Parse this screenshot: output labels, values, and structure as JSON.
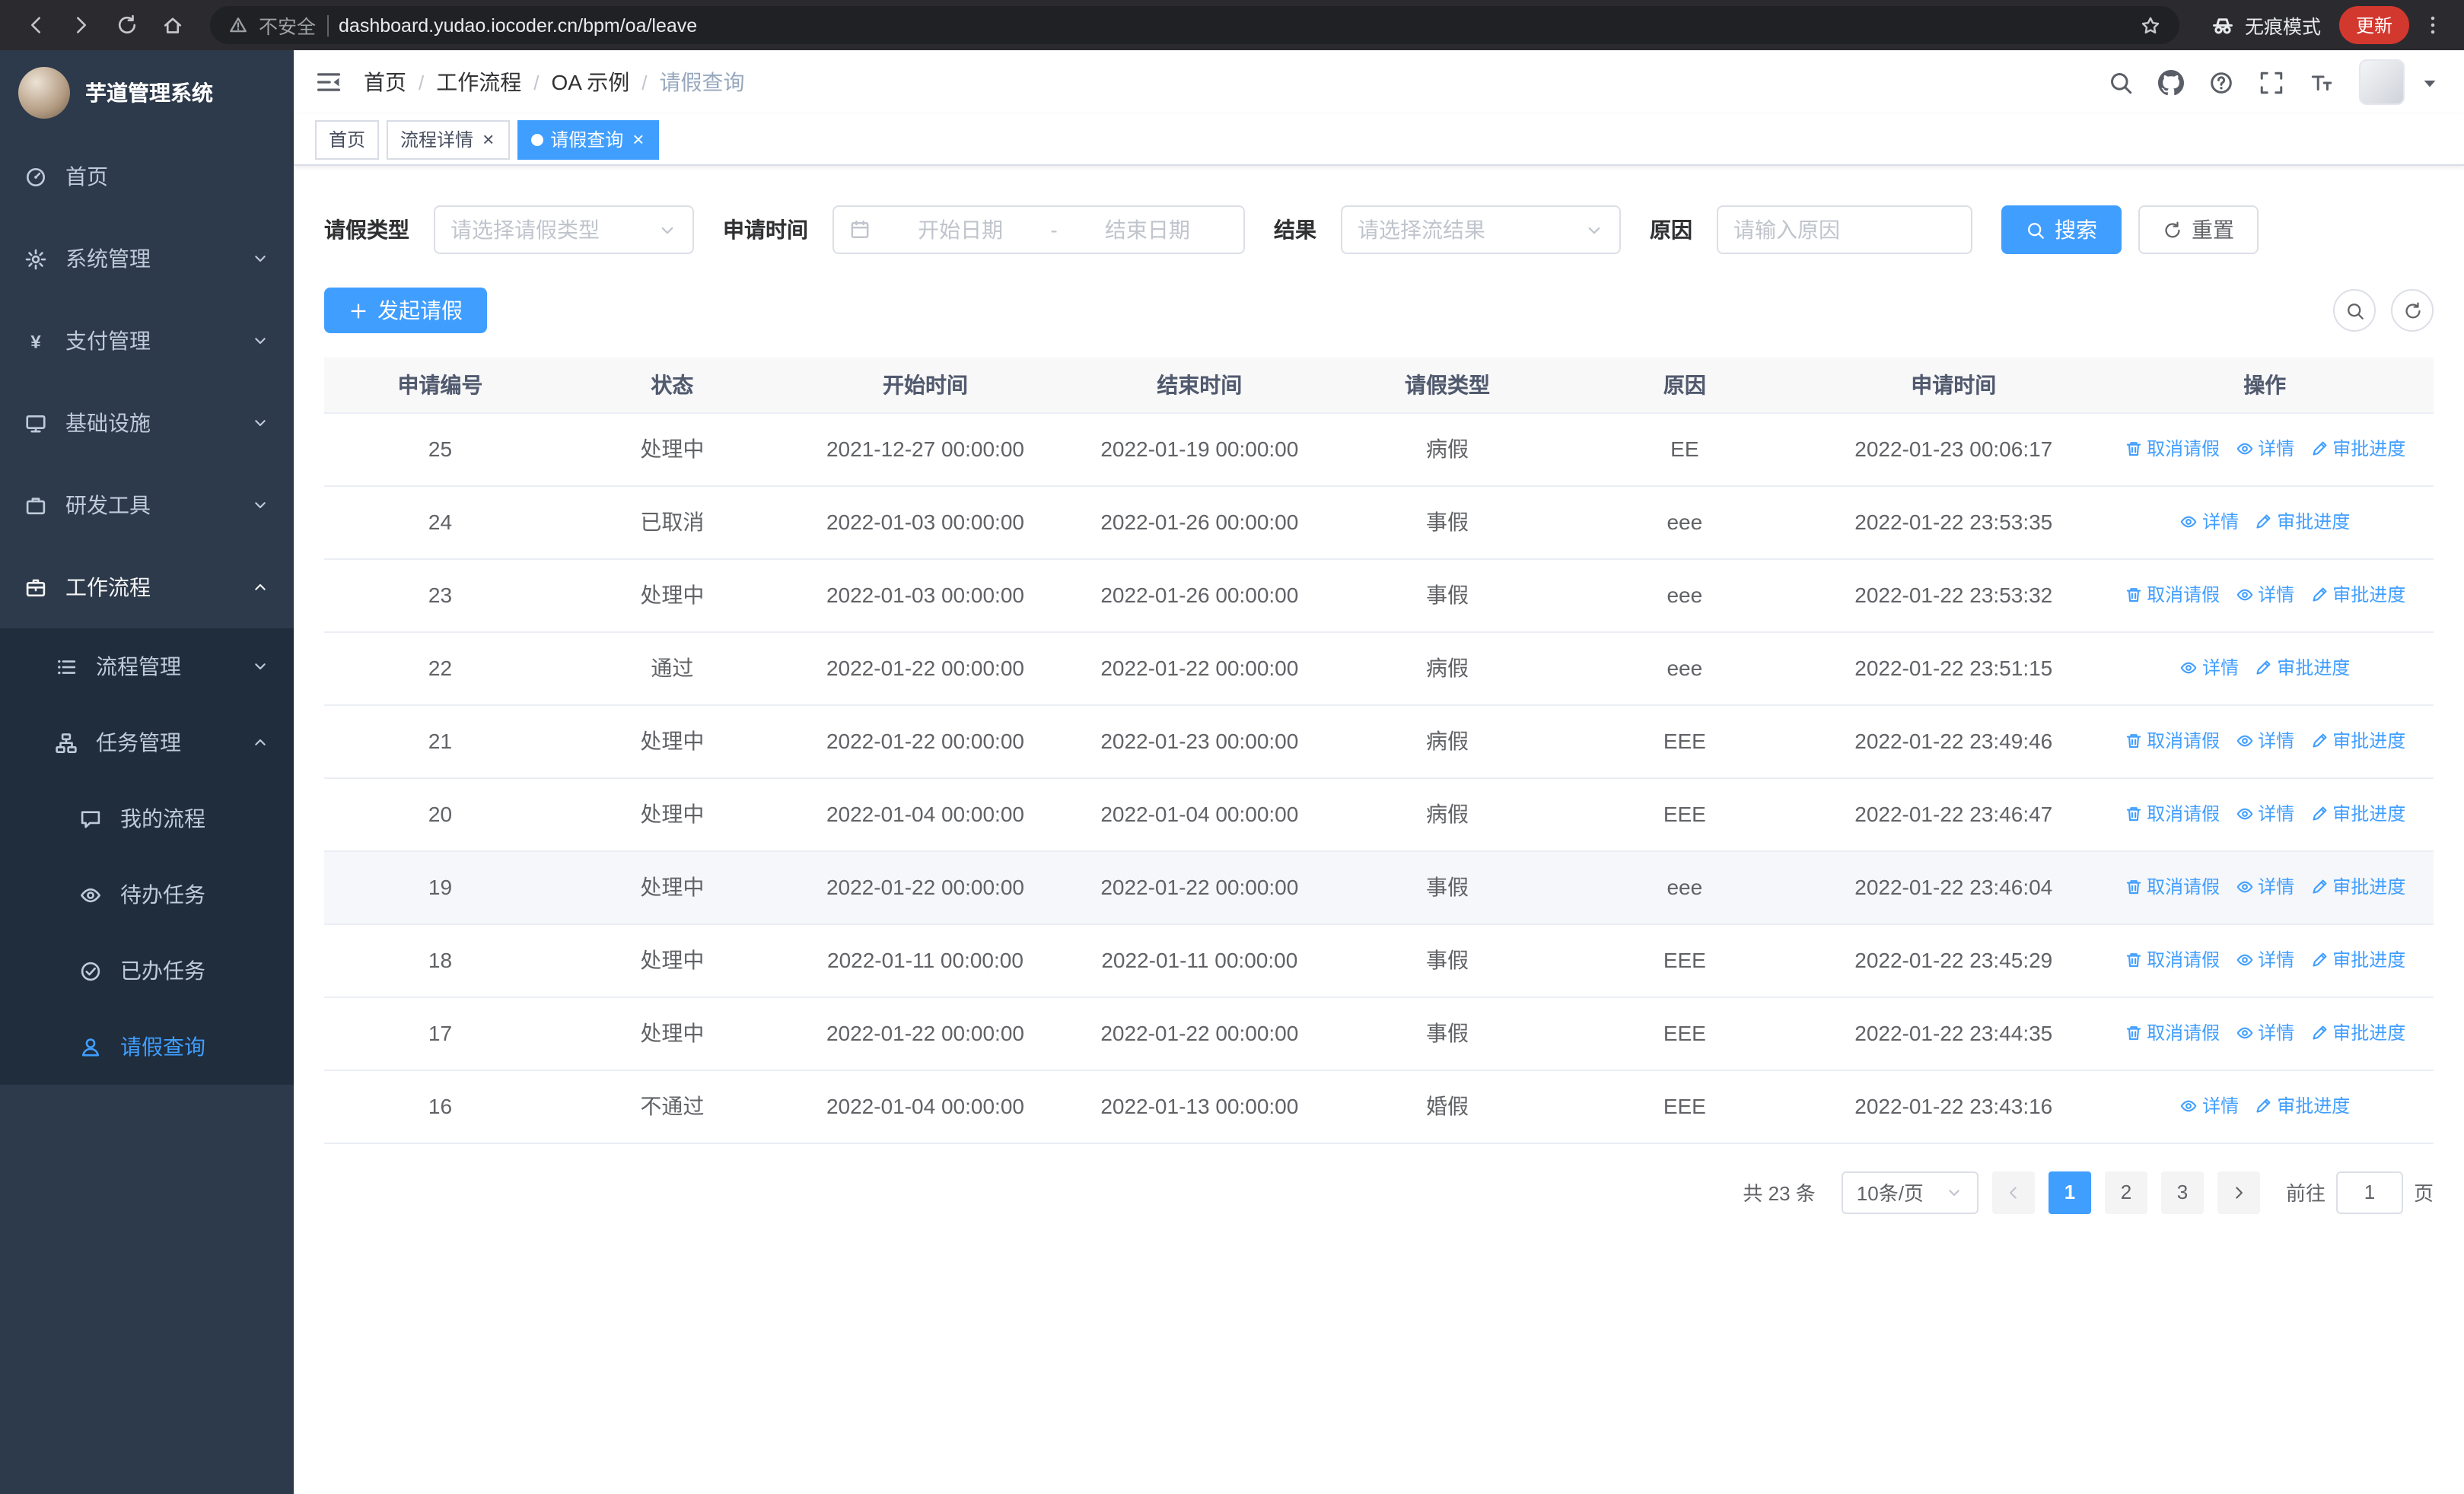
{
  "colors": {
    "primary": "#409eff",
    "sidebar_bg": "#2d3a4b",
    "sidebar_submenu_bg": "#1f2d3d",
    "sidebar_text": "#bfcbd9",
    "active_text": "#409eff",
    "table_border": "#ebeef5",
    "update_pill_red": "#d3382f"
  },
  "browser": {
    "security_label": "不安全",
    "url": "dashboard.yudao.iocoder.cn/bpm/oa/leave",
    "incognito_label": "无痕模式",
    "update_label": "更新"
  },
  "sidebar": {
    "title": "芋道管理系统",
    "menu": [
      {
        "name": "home",
        "label": "首页",
        "icon": "dashboard-icon",
        "level": 1
      },
      {
        "name": "system-management",
        "label": "系统管理",
        "icon": "gear-icon",
        "level": 1,
        "chevron": "down"
      },
      {
        "name": "payment-management",
        "label": "支付管理",
        "icon": "yen-icon",
        "level": 1,
        "chevron": "down"
      },
      {
        "name": "infrastructure",
        "label": "基础设施",
        "icon": "infra-icon",
        "level": 1,
        "chevron": "down"
      },
      {
        "name": "dev-tools",
        "label": "研发工具",
        "icon": "tools-icon",
        "level": 1,
        "chevron": "down"
      },
      {
        "name": "workflow",
        "label": "工作流程",
        "icon": "workflow-icon",
        "level": 1,
        "chevron": "up",
        "expanded": true
      },
      {
        "name": "process-management",
        "label": "流程管理",
        "icon": "process-icon",
        "level": 2,
        "chevron": "down"
      },
      {
        "name": "task-management",
        "label": "任务管理",
        "icon": "task-icon",
        "level": 2,
        "chevron": "up"
      },
      {
        "name": "my-process",
        "label": "我的流程",
        "icon": "chat-icon",
        "level": 3
      },
      {
        "name": "todo-task",
        "label": "待办任务",
        "icon": "eye-icon",
        "level": 3
      },
      {
        "name": "done-task",
        "label": "已办任务",
        "icon": "done-icon",
        "level": 3
      },
      {
        "name": "leave-query",
        "label": "请假查询",
        "icon": "user-icon",
        "level": 3,
        "active": true
      }
    ]
  },
  "header": {
    "breadcrumb": [
      "首页",
      "工作流程",
      "OA 示例",
      "请假查询"
    ]
  },
  "tabs": [
    {
      "label": "首页",
      "closable": false,
      "active": false
    },
    {
      "label": "流程详情",
      "closable": true,
      "active": false
    },
    {
      "label": "请假查询",
      "closable": true,
      "active": true
    }
  ],
  "filters": {
    "leave_type_label": "请假类型",
    "leave_type_placeholder": "请选择请假类型",
    "apply_time_label": "申请时间",
    "start_date_placeholder": "开始日期",
    "range_separator": "-",
    "end_date_placeholder": "结束日期",
    "result_label": "结果",
    "result_placeholder": "请选择流结果",
    "reason_label": "原因",
    "reason_placeholder": "请输入原因",
    "search_button": "搜索",
    "reset_button": "重置"
  },
  "toolbar": {
    "create_button": "发起请假"
  },
  "table": {
    "headers": [
      "申请编号",
      "状态",
      "开始时间",
      "结束时间",
      "请假类型",
      "原因",
      "申请时间",
      "操作"
    ],
    "actions": {
      "cancel": "取消请假",
      "detail": "详情",
      "progress": "审批进度"
    },
    "rows": [
      {
        "id": "25",
        "status": "处理中",
        "start": "2021-12-27 00:00:00",
        "end": "2022-01-19 00:00:00",
        "type": "病假",
        "reason": "EE",
        "applied": "2022-01-23 00:06:17",
        "cancellable": true
      },
      {
        "id": "24",
        "status": "已取消",
        "start": "2022-01-03 00:00:00",
        "end": "2022-01-26 00:00:00",
        "type": "事假",
        "reason": "eee",
        "applied": "2022-01-22 23:53:35",
        "cancellable": false
      },
      {
        "id": "23",
        "status": "处理中",
        "start": "2022-01-03 00:00:00",
        "end": "2022-01-26 00:00:00",
        "type": "事假",
        "reason": "eee",
        "applied": "2022-01-22 23:53:32",
        "cancellable": true
      },
      {
        "id": "22",
        "status": "通过",
        "start": "2022-01-22 00:00:00",
        "end": "2022-01-22 00:00:00",
        "type": "病假",
        "reason": "eee",
        "applied": "2022-01-22 23:51:15",
        "cancellable": false
      },
      {
        "id": "21",
        "status": "处理中",
        "start": "2022-01-22 00:00:00",
        "end": "2022-01-23 00:00:00",
        "type": "病假",
        "reason": "EEE",
        "applied": "2022-01-22 23:49:46",
        "cancellable": true
      },
      {
        "id": "20",
        "status": "处理中",
        "start": "2022-01-04 00:00:00",
        "end": "2022-01-04 00:00:00",
        "type": "病假",
        "reason": "EEE",
        "applied": "2022-01-22 23:46:47",
        "cancellable": true
      },
      {
        "id": "19",
        "status": "处理中",
        "start": "2022-01-22 00:00:00",
        "end": "2022-01-22 00:00:00",
        "type": "事假",
        "reason": "eee",
        "applied": "2022-01-22 23:46:04",
        "cancellable": true,
        "highlight": true
      },
      {
        "id": "18",
        "status": "处理中",
        "start": "2022-01-11 00:00:00",
        "end": "2022-01-11 00:00:00",
        "type": "事假",
        "reason": "EEE",
        "applied": "2022-01-22 23:45:29",
        "cancellable": true
      },
      {
        "id": "17",
        "status": "处理中",
        "start": "2022-01-22 00:00:00",
        "end": "2022-01-22 00:00:00",
        "type": "事假",
        "reason": "EEE",
        "applied": "2022-01-22 23:44:35",
        "cancellable": true
      },
      {
        "id": "16",
        "status": "不通过",
        "start": "2022-01-04 00:00:00",
        "end": "2022-01-13 00:00:00",
        "type": "婚假",
        "reason": "EEE",
        "applied": "2022-01-22 23:43:16",
        "cancellable": false
      }
    ]
  },
  "pagination": {
    "total_text": "共 23 条",
    "page_size_label": "10条/页",
    "pages": [
      "1",
      "2",
      "3"
    ],
    "active_page": "1",
    "goto_prefix": "前往",
    "goto_value": "1",
    "goto_suffix": "页"
  }
}
